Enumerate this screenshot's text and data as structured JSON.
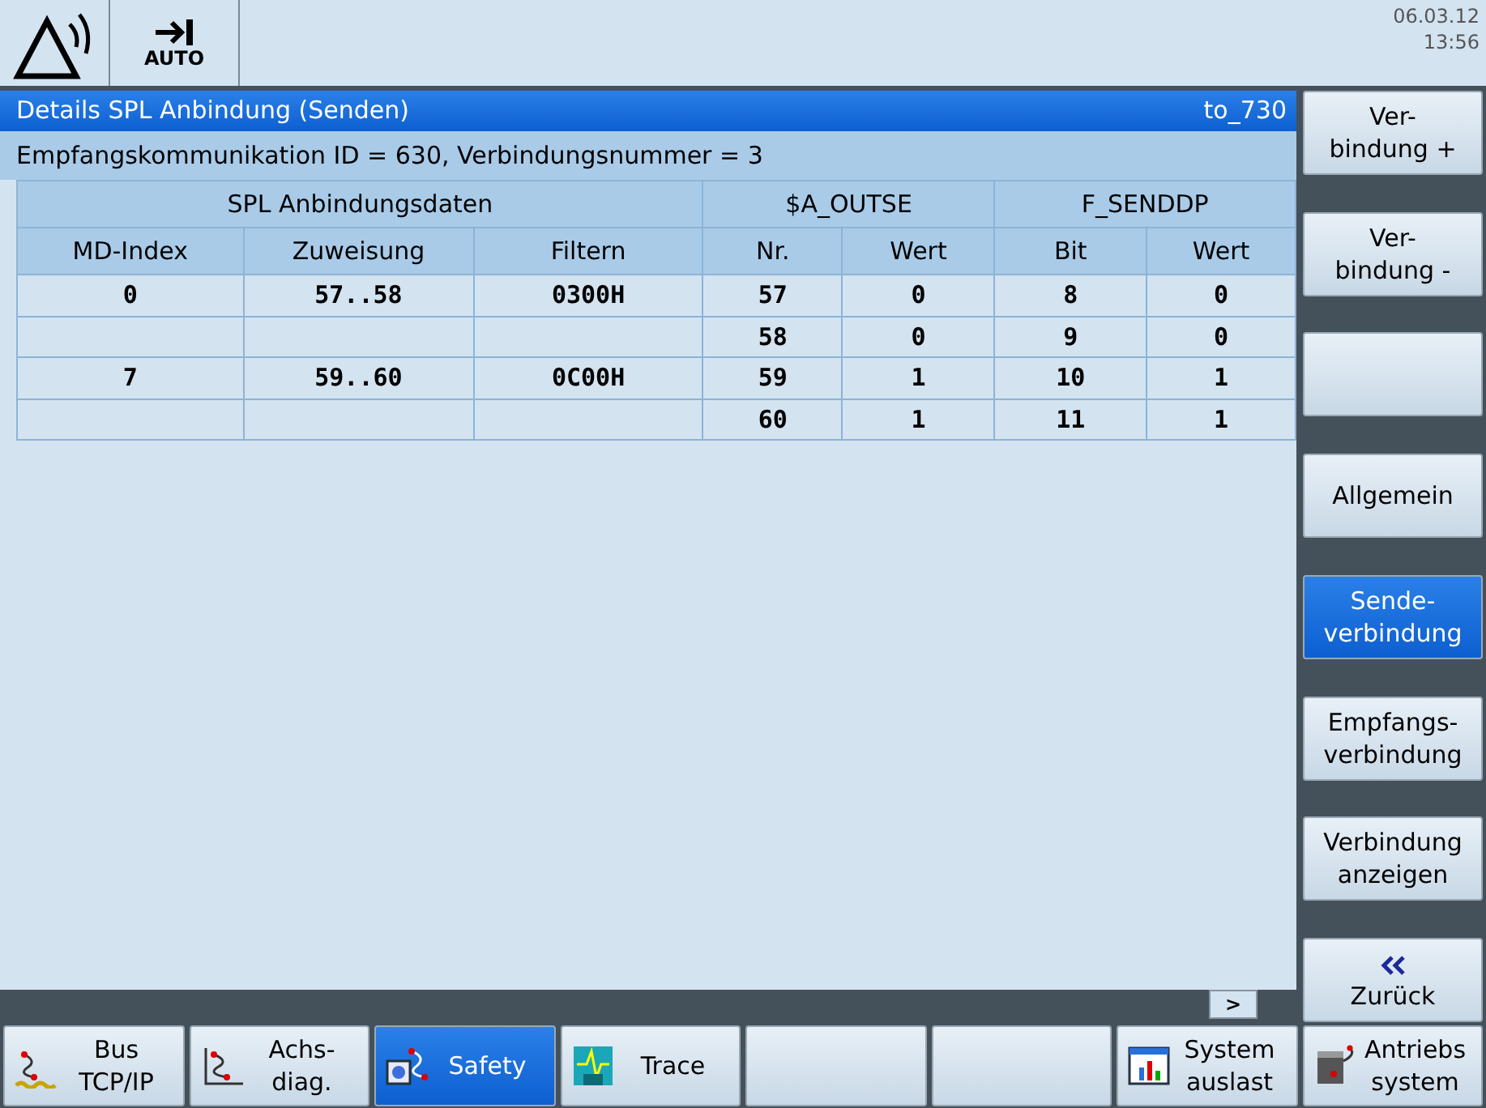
{
  "header": {
    "mode": "AUTO",
    "date": "06.03.12",
    "time": "13:56"
  },
  "panel": {
    "title": "Details SPL Anbindung (Senden)",
    "tag": "to_730",
    "info": "Empfangskommunikation ID = 630, Verbindungsnummer = 3"
  },
  "table": {
    "groups": [
      {
        "label": "SPL Anbindungsdaten",
        "columns": [
          "MD-Index",
          "Zuweisung",
          "Filtern"
        ]
      },
      {
        "label": "$A_OUTSE",
        "columns": [
          "Nr.",
          "Wert"
        ]
      },
      {
        "label": "F_SENDDP",
        "columns": [
          "Bit",
          "Wert"
        ]
      }
    ],
    "rows": [
      [
        "0",
        "57..58",
        "0300H",
        "57",
        "0",
        "8",
        "0"
      ],
      [
        null,
        null,
        null,
        "58",
        "0",
        "9",
        "0"
      ],
      [
        "7",
        "59..60",
        "0C00H",
        "59",
        "1",
        "10",
        "1"
      ],
      [
        null,
        null,
        null,
        "60",
        "1",
        "11",
        "1"
      ]
    ]
  },
  "scroll_arrow": ">",
  "vertical_softkeys": [
    {
      "kind": "text",
      "label": "Ver-\nbindung +",
      "selected": false
    },
    {
      "kind": "text",
      "label": "Ver-\nbindung -",
      "selected": false
    },
    {
      "kind": "blank",
      "selected": false
    },
    {
      "kind": "text",
      "label": "Allgemein",
      "selected": false
    },
    {
      "kind": "text",
      "label": "Sende-\nverbindung",
      "selected": true
    },
    {
      "kind": "text",
      "label": "Empfangs-\nverbindung",
      "selected": false
    },
    {
      "kind": "text",
      "label": "Verbindung\nanzeigen",
      "selected": false
    },
    {
      "kind": "back",
      "label": "Zurück",
      "selected": false
    }
  ],
  "horizontal_softkeys": [
    {
      "kind": "bus",
      "label": "Bus\nTCP/IP",
      "selected": false
    },
    {
      "kind": "axis",
      "label": "Achs-\ndiag.",
      "selected": false
    },
    {
      "kind": "safety",
      "label": "Safety",
      "selected": true
    },
    {
      "kind": "trace",
      "label": "Trace",
      "selected": false
    },
    {
      "kind": "blank",
      "selected": false
    },
    {
      "kind": "blank",
      "selected": false
    },
    {
      "kind": "load",
      "label": "System\nauslast",
      "selected": false
    },
    {
      "kind": "drive",
      "label": "Antriebs\nsystem",
      "selected": false
    }
  ]
}
